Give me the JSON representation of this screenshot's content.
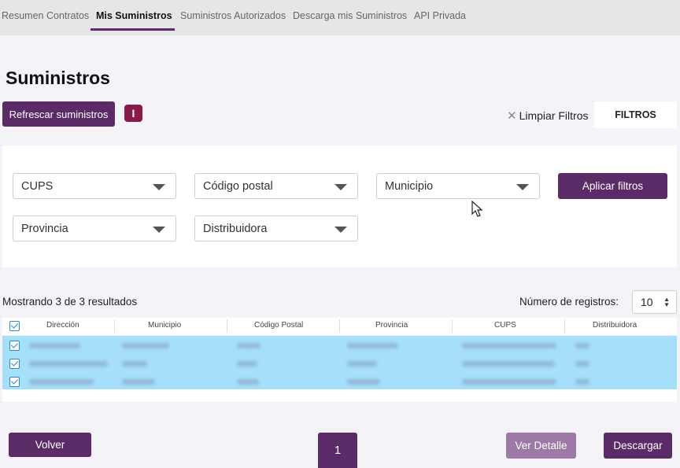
{
  "nav": {
    "tabs": [
      {
        "label": "Resumen Contratos"
      },
      {
        "label": "Mis Suministros"
      },
      {
        "label": "Suministros Autorizados"
      },
      {
        "label": "Descarga mis Suministros"
      },
      {
        "label": "API Privada"
      }
    ],
    "active_tab": "Mis Suministros"
  },
  "page": {
    "title": "Suministros",
    "refresh_label": "Refrescar suministros",
    "info_label": "I",
    "clear_filters_label": "Limpiar Filtros",
    "filters_tab_label": "FILTROS"
  },
  "filters": {
    "cups": "CUPS",
    "postal_code": "Código postal",
    "municipality": "Municipio",
    "province": "Provincia",
    "distributor": "Distribuidora",
    "apply_label": "Aplicar filtros"
  },
  "results": {
    "summary": "Mostrando 3 de 3 resultados",
    "records_label": "Número de registros:",
    "records_value": "10"
  },
  "table": {
    "columns": [
      "Dirección",
      "Municipio",
      "Código Postal",
      "Provincia",
      "CUPS",
      "Distribuidora"
    ],
    "row_count_visible": 3,
    "rows_content": "blurred",
    "rows_checked": [
      true,
      true,
      true
    ]
  },
  "footer": {
    "back_label": "Volver",
    "page_number": "1",
    "detail_label": "Ver Detalle",
    "download_label": "Descargar"
  },
  "colors": {
    "primary": "#5a2b66",
    "info_badge": "#8b1a4a",
    "selected_row": "#a6dffa",
    "detail_button": "#9d7aa5"
  }
}
